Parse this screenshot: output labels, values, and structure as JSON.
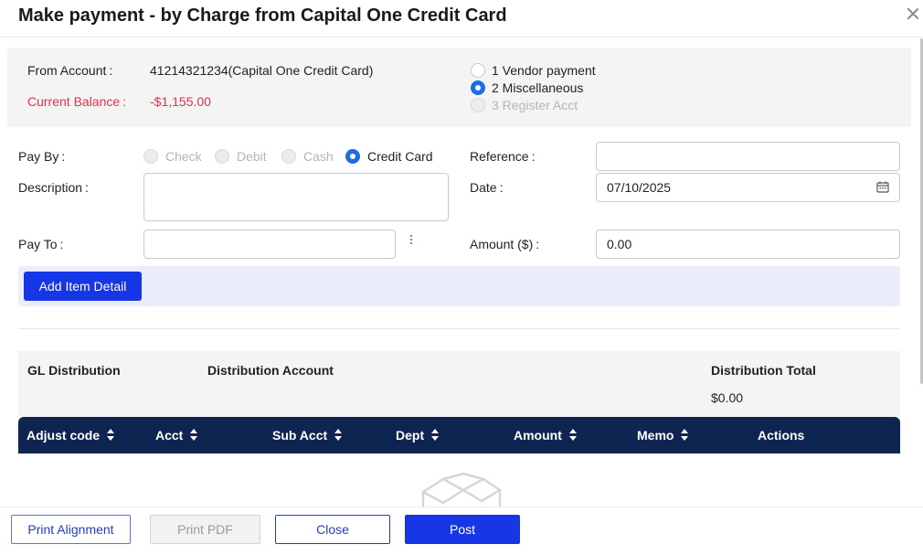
{
  "dialog": {
    "title": "Make payment - by Charge from Capital One Credit Card",
    "close_icon": "close-icon"
  },
  "account": {
    "from_label": "From Account",
    "from_value": "41214321234(Capital One Credit Card)",
    "balance_label": "Current Balance",
    "balance_value": "-$1,155.00",
    "colon": ":",
    "type_options": [
      {
        "label": "1 Vendor payment",
        "checked": false,
        "disabled": false
      },
      {
        "label": "2 Miscellaneous",
        "checked": true,
        "disabled": false
      },
      {
        "label": "3 Register Acct",
        "checked": false,
        "disabled": true
      }
    ]
  },
  "form": {
    "pay_by_label": "Pay By",
    "pay_by_options": [
      {
        "label": "Check",
        "checked": false,
        "disabled": true
      },
      {
        "label": "Debit",
        "checked": false,
        "disabled": true
      },
      {
        "label": "Cash",
        "checked": false,
        "disabled": true
      },
      {
        "label": "Credit Card",
        "checked": true,
        "disabled": false
      }
    ],
    "description_label": "Description",
    "description_value": "",
    "pay_to_label": "Pay To",
    "pay_to_value": "",
    "reference_label": "Reference",
    "reference_value": "",
    "date_label": "Date",
    "date_value": "07/10/2025",
    "amount_label": "Amount ($)",
    "amount_value": "0.00",
    "add_item_label": "Add Item Detail"
  },
  "gl": {
    "distribution_label": "GL Distribution",
    "account_label": "Distribution Account",
    "total_label": "Distribution Total",
    "total_value": "$0.00"
  },
  "table": {
    "columns": [
      "Adjust code",
      "Acct",
      "Sub Acct",
      "Dept",
      "Amount",
      "Memo",
      "Actions"
    ]
  },
  "footer": {
    "print_alignment": "Print Alignment",
    "print_pdf": "Print PDF",
    "close": "Close",
    "post": "Post"
  },
  "colors": {
    "primary": "#1736e6",
    "table_header": "#0f2551",
    "balance_red": "#e0344b",
    "radio_checked": "#1b6fe0"
  }
}
